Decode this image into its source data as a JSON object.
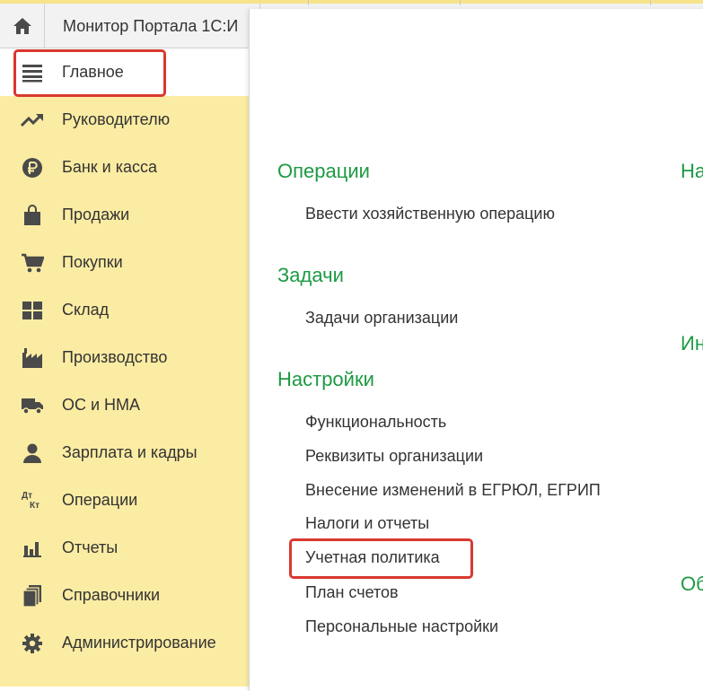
{
  "header": {
    "tab_title": "Монитор Портала 1С:И"
  },
  "sidebar": {
    "items": [
      {
        "label": "Главное",
        "icon": "menu-icon"
      },
      {
        "label": "Руководителю",
        "icon": "trend-icon"
      },
      {
        "label": "Банк и касса",
        "icon": "ruble-icon"
      },
      {
        "label": "Продажи",
        "icon": "shopping-bag-icon"
      },
      {
        "label": "Покупки",
        "icon": "cart-icon"
      },
      {
        "label": "Склад",
        "icon": "warehouse-grid-icon"
      },
      {
        "label": "Производство",
        "icon": "factory-icon"
      },
      {
        "label": "ОС и НМА",
        "icon": "truck-icon"
      },
      {
        "label": "Зарплата и кадры",
        "icon": "person-icon"
      },
      {
        "label": "Операции",
        "icon": "debit-credit-icon"
      },
      {
        "label": "Отчеты",
        "icon": "bar-chart-icon"
      },
      {
        "label": "Справочники",
        "icon": "books-icon"
      },
      {
        "label": "Администрирование",
        "icon": "gear-icon"
      }
    ],
    "debit_credit_glyph": {
      "top": "Дт",
      "bottom": "Кт"
    }
  },
  "panel": {
    "sections": [
      {
        "title": "Операции",
        "links": [
          "Ввести хозяйственную операцию"
        ]
      },
      {
        "title": "Задачи",
        "links": [
          "Задачи организации"
        ]
      },
      {
        "title": "Настройки",
        "links": [
          "Функциональность",
          "Реквизиты организации",
          "Внесение изменений в ЕГРЮЛ, ЕГРИП",
          "Налоги и отчеты",
          "Учетная политика",
          "План счетов",
          "Персональные настройки"
        ]
      }
    ],
    "right_column_fragments": [
      "На",
      "Ин",
      "Об"
    ]
  },
  "colors": {
    "sidebar_bg": "#fbeca3",
    "section_title": "#1e9a43",
    "highlight": "#d9382f"
  }
}
